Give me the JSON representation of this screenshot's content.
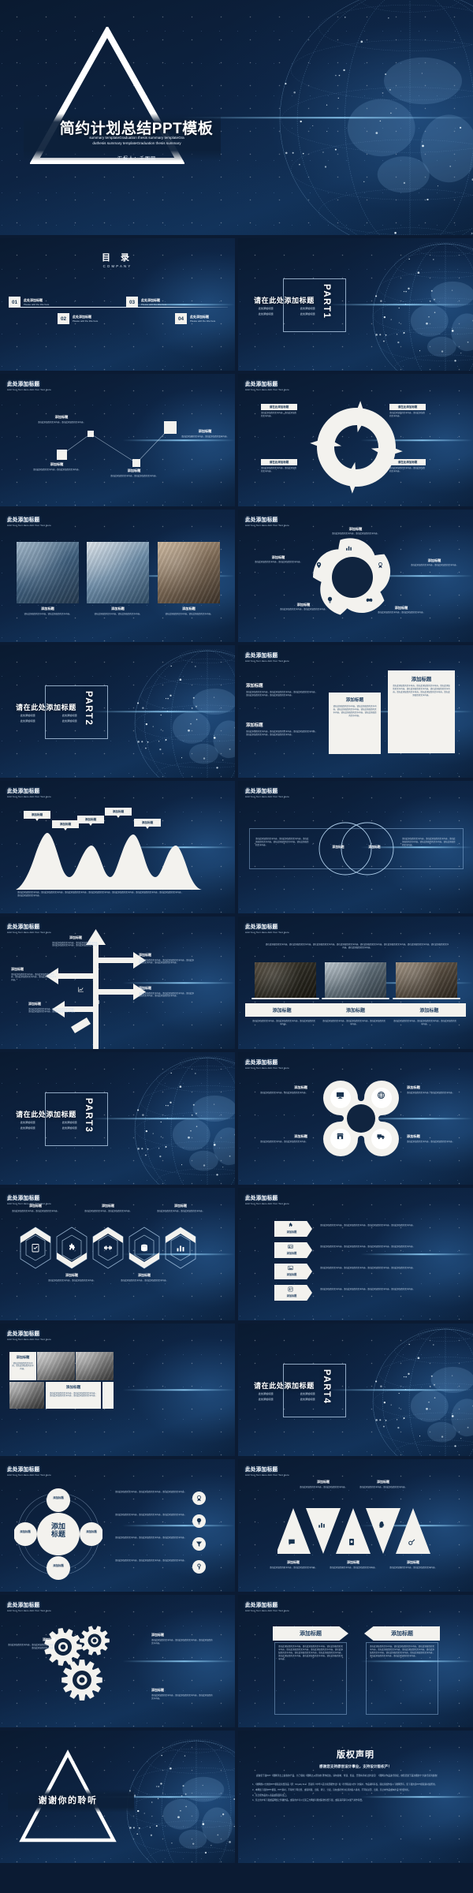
{
  "meta": {
    "accent": "#123055",
    "card": "#f3f2ee",
    "ink": "#17324f",
    "glow": "#8fc6ff"
  },
  "cover": {
    "title": "简约计划总结PPT模板",
    "subtitle_line1": "summary templateGraduation thesis summary templateGra",
    "subtitle_line2": "duthesis summary templateGraduation thesis summary",
    "presenter": "汇报人：千图网"
  },
  "toc": {
    "title": "目 录",
    "subtitle": "COMPANY",
    "items": [
      {
        "num": "01",
        "cn": "此处添加标题",
        "en": "Please add the title here"
      },
      {
        "num": "02",
        "cn": "此处添加标题",
        "en": "Please add the title here"
      },
      {
        "num": "03",
        "cn": "此处添加标题",
        "en": "Please add the title here"
      },
      {
        "num": "04",
        "cn": "此处添加标题",
        "en": "Please add the title here"
      }
    ]
  },
  "common": {
    "slide_title": "此处添加标题",
    "slide_subtitle": "Add Your Text Here Add Your Text Here",
    "add_title": "添加标题",
    "add_title_here": "请在此处添加标题",
    "body_short": "请在此添加您的文字内容，请在此添加您的文字内容。",
    "body_med": "请在此添加您的文字内容，请在此添加您的文字内容，请在此添加您的文字内容，请在此添加您的文字内容。",
    "body_long": "请在此添加您的文字内容，请在此添加您的文字内容，请在此添加您的文字内容，请在此添加您的文字内容，请在此添加您的文字内容，请在此添加您的文字内容，请在此添加您的文字内容。",
    "bullet": "此处添加标题"
  },
  "parts": [
    {
      "num": "PART1",
      "title": "请在此处添加标题",
      "bullets": [
        "此处添加标题",
        "此处添加标题",
        "此处添加标题",
        "此处添加标题"
      ]
    },
    {
      "num": "PART2",
      "title": "请在此处添加标题",
      "bullets": [
        "此处添加标题",
        "此处添加标题",
        "此处添加标题",
        "此处添加标题"
      ]
    },
    {
      "num": "PART3",
      "title": "请在此处添加标题",
      "bullets": [
        "此处添加标题",
        "此处添加标题",
        "此处添加标题",
        "此处添加标题"
      ]
    },
    {
      "num": "PART4",
      "title": "请在此处添加标题",
      "bullets": [
        "此处添加标题",
        "此处添加标题",
        "此处添加标题",
        "此处添加标题"
      ]
    }
  ],
  "zigzag": {
    "nodes": [
      {
        "label": "添加标题",
        "body": "请在此添加您的文字内容，请在此添加您的文字内容。"
      },
      {
        "label": "添加标题",
        "body": "请在此添加您的文字内容，请在此添加您的文字内容。"
      },
      {
        "label": "添加标题",
        "body": "请在此添加您的文字内容，请在此添加您的文字内容。"
      },
      {
        "label": "添加标题",
        "body": "请在此添加您的文字内容，请在此添加您的文字内容。"
      }
    ]
  },
  "cycle": {
    "items": [
      {
        "label": "请在此添加标题",
        "body": "请在此添加您的文字内容，请在此添加您的文字内容。"
      },
      {
        "label": "请在此添加标题",
        "body": "请在此添加您的文字内容，请在此添加您的文字内容。"
      },
      {
        "label": "请在此添加标题",
        "body": "请在此添加您的文字内容，请在此添加您的文字内容。"
      },
      {
        "label": "请在此添加标题",
        "body": "请在此添加您的文字内容，请在此添加您的文字内容。"
      }
    ]
  },
  "photos3": {
    "items": [
      {
        "label": "添加标题",
        "body": "请在此添加您的文字内容，请在此添加您的文字内容。"
      },
      {
        "label": "添加标题",
        "body": "请在此添加您的文字内容，请在此添加您的文字内容。"
      },
      {
        "label": "添加标题",
        "body": "请在此添加您的文字内容，请在此添加您的文字内容。"
      }
    ]
  },
  "pinwheel": {
    "items": [
      {
        "label": "添加标题",
        "body": "请在此添加您的文字内容，请在此添加您的文字内容。",
        "icon": "chart-bar-icon"
      },
      {
        "label": "添加标题",
        "body": "请在此添加您的文字内容，请在此添加您的文字内容。",
        "icon": "medal-icon"
      },
      {
        "label": "添加标题",
        "body": "请在此添加您的文字内容，请在此添加您的文字内容。",
        "icon": "handshake-icon"
      },
      {
        "label": "添加标题",
        "body": "请在此添加您的文字内容，请在此添加您的文字内容。",
        "icon": "lightbulb-icon"
      },
      {
        "label": "添加标题",
        "body": "请在此添加您的文字内容，请在此添加您的文字内容。",
        "icon": "location-pin-icon"
      }
    ]
  },
  "threecols": {
    "left": [
      {
        "label": "添加标题",
        "body": "请在此添加您的文字内容，请在此添加您的文字内容，请在此添加您的文字内容，请在此添加您的文字内容，请在此添加您的文字内容。"
      },
      {
        "label": "添加标题",
        "body": "请在此添加您的文字内容，请在此添加您的文字内容，请在此添加您的文字内容，请在此添加您的文字内容，请在此添加您的文字内容。"
      }
    ],
    "mid": {
      "label": "添加标题",
      "body": "请在此添加您的文字内容，请在此添加您的文字内容，请在此添加您的文字内容，请在此添加您的文字内容，请在此添加您的文字内容，请在此添加您的文字内容。"
    },
    "right": {
      "label": "添加标题",
      "body": "请在此添加您的文字内容，请在此添加您的文字内容，请在此添加您的文字内容，请在此添加您的文字内容，请在此添加您的文字内容，请在此添加您的文字内容，请在此添加您的文字内容，请在此添加您的文字内容。"
    }
  },
  "mountains": {
    "labels": [
      "添加标题",
      "添加标题",
      "添加标题",
      "添加标题",
      "添加标题"
    ],
    "caption": "请在此添加您的文字内容，请在此添加您的文字内容，请在此添加您的文字内容，请在此添加您的文字内容，请在此添加您的文字内容，请在此添加您的文字内容，请在此添加您的文字内容，请在此添加您的文字内容。"
  },
  "venn": {
    "left_body": "请在此添加您的文字内容，请在此添加您的文字内容，请在此添加您的文字内容，请在此添加您的文字内容，请在此添加您的文字内容。",
    "right_body": "请在此添加您的文字内容，请在此添加您的文字内容，请在此添加您的文字内容，请在此添加您的文字内容，请在此添加您的文字内容。",
    "circle_left": "添加标题",
    "circle_right": "添加标题"
  },
  "arrowtree": {
    "items": [
      {
        "label": "添加标题",
        "body": "请在此添加您的文字内容，请在此添加您的文字内容，请在此添加您的文字内容，请在此添加您的文字内容。",
        "icon": "globe-icon"
      },
      {
        "label": "添加标题",
        "body": "请在此添加您的文字内容，请在此添加您的文字内容，请在此添加您的文字内容，请在此添加您的文字内容。",
        "icon": "group-icon"
      },
      {
        "label": "添加标题",
        "body": "请在此添加您的文字内容，请在此添加您的文字内容，请在此添加您的文字内容，请在此添加您的文字内容。",
        "icon": "chart-line-icon"
      },
      {
        "label": "添加标题",
        "body": "请在此添加您的文字内容，请在此添加您的文字内容，请在此添加您的文字内容，请在此添加您的文字内容。",
        "icon": "football-icon"
      },
      {
        "label": "添加标题",
        "body": "请在此添加您的文字内容，请在此添加您的文字内容，请在此添加您的文字内容，请在此添加您的文字内容。",
        "icon": "paper-plane-icon"
      }
    ]
  },
  "laptops": {
    "intro": "请在此添加您的文字内容，请在此添加您的文字内容，请在此添加您的文字内容，请在此添加您的文字内容，请在此添加您的文字内容，请在此添加您的文字内容，请在此添加您的文字内容，请在此添加您的文字内容，请在此添加您的文字内容。",
    "items": [
      {
        "label": "添加标题",
        "body": "请在此添加您的文字内容，请在此添加您的文字内容，请在此添加您的文字内容。"
      },
      {
        "label": "添加标题",
        "body": "请在此添加您的文字内容，请在此添加您的文字内容，请在此添加您的文字内容。"
      },
      {
        "label": "添加标题",
        "body": "请在此添加您的文字内容，请在此添加您的文字内容，请在此添加您的文字内容。"
      }
    ]
  },
  "quadhub": {
    "items": [
      {
        "label": "添加标题",
        "body": "请在此添加您的文字内容，请在此添加您的文字内容。",
        "icon": "monitor-icon"
      },
      {
        "label": "添加标题",
        "body": "请在此添加您的文字内容，请在此添加您的文字内容。",
        "icon": "globe-grid-icon"
      },
      {
        "label": "添加标题",
        "body": "请在此添加您的文字内容，请在此添加您的文字内容。",
        "icon": "store-icon"
      },
      {
        "label": "添加标题",
        "body": "请在此添加您的文字内容，请在此添加您的文字内容。",
        "icon": "truck-icon"
      }
    ]
  },
  "hexicons": {
    "items": [
      {
        "label": "添加标题",
        "body": "请在此添加您的文字内容，请在此添加您的文字内容。",
        "icon": "checklist-icon"
      },
      {
        "label": "添加标题",
        "body": "请在此添加您的文字内容，请在此添加您的文字内容。",
        "icon": "puzzle-icon"
      },
      {
        "label": "添加标题",
        "body": "请在此添加您的文字内容，请在此添加您的文字内容。",
        "icon": "dumbbell-icon"
      },
      {
        "label": "添加标题",
        "body": "请在此添加您的文字内容，请在此添加您的文字内容。",
        "icon": "database-icon"
      },
      {
        "label": "添加标题",
        "body": "请在此添加您的文字内容，请在此添加您的文字内容。",
        "icon": "bar-chart-icon"
      }
    ]
  },
  "chevrons": {
    "items": [
      {
        "label": "添加标题",
        "body": "请在此添加您的文字内容。请在此添加您的文字内容。请在此添加您的文字内容。请在此添加您的文字内容。",
        "icon": "puzzle-piece-icon"
      },
      {
        "label": "添加标题",
        "body": "请在此添加您的文字内容。请在此添加您的文字内容。请在此添加您的文字内容。请在此添加您的文字内容。",
        "icon": "id-card-icon"
      },
      {
        "label": "添加标题",
        "body": "请在此添加您的文字内容。请在此添加您的文字内容。请在此添加您的文字内容。请在此添加您的文字内容。",
        "icon": "picture-icon"
      },
      {
        "label": "添加标题",
        "body": "请在此添加您的文字内容。请在此添加您的文字内容。请在此添加您的文字内容。请在此添加您的文字内容。",
        "icon": "contacts-icon"
      }
    ]
  },
  "mosaic": {
    "cell1": {
      "label": "添加标题",
      "body": "请在此添加您的文字内容，请在此添加您的文字内容。"
    },
    "cell2": {
      "label": "添加标题",
      "body": "请在此添加您的文字内容，请在此添加您的文字内容，请在此添加您的文字内容，请在此添加您的文字内容。"
    }
  },
  "centerhub": {
    "center_line1": "添加",
    "center_line2": "标题",
    "satellites": [
      "添加标题",
      "添加标题",
      "添加标题",
      "添加标题"
    ],
    "rows": [
      {
        "body": "请在此添加您的文字内容，请在此添加您的文字内容，请在此添加您的文字内容。",
        "icon": "award-icon"
      },
      {
        "body": "请在此添加您的文字内容，请在此添加您的文字内容，请在此添加您的文字内容。",
        "icon": "lightbulb-icon"
      },
      {
        "body": "请在此添加您的文字内容，请在此添加您的文字内容，请在此添加您的文字内容。",
        "icon": "funnel-icon"
      },
      {
        "body": "请在此添加您的文字内容，请在此添加您的文字内容，请在此添加您的文字内容。",
        "icon": "key-icon"
      }
    ]
  },
  "triangles": {
    "top": [
      {
        "label": "添加标题",
        "body": "请在此添加您的文字内容，请在此添加您的文字内容。"
      },
      {
        "label": "添加标题",
        "body": "请在此添加您的文字内容，请在此添加您的文字内容。"
      }
    ],
    "bottom": [
      {
        "label": "添加标题",
        "body": "请在此添加您的文字内容，请在此添加您的文字内容。"
      },
      {
        "label": "添加标题",
        "body": "请在此添加您的文字内容，请在此添加您的文字内容。"
      },
      {
        "label": "添加标题",
        "body": "请在此添加您的文字内容，请在此添加您的文字内容。"
      }
    ],
    "icons": [
      "chat-icon",
      "bar-chart-icon",
      "mobile-icon",
      "head-idea-icon",
      "wrench-gear-icon"
    ]
  },
  "gears": {
    "left": {
      "label": "添加标题",
      "body": "请在此添加您的文字内容，请在此添加您的文字内容，请在此添加您的文字内容。"
    },
    "right_top": {
      "label": "添加标题",
      "body": "请在此添加您的文字内容，请在此添加您的文字内容，请在此添加您的文字内容。"
    },
    "right_bottom": {
      "label": "添加标题",
      "body": "请在此添加您的文字内容，请在此添加您的文字内容，请在此添加您的文字内容。"
    }
  },
  "banners": {
    "left": {
      "label": "添加标题",
      "body": "请在此添加您的文字内容，请在此添加您的文字内容，请在此添加您的文字内容，请在此添加您的文字内容，请在此添加您的文字内容，请在此添加您的文字内容，请在此添加您的文字内容，请在此添加您的文字内容，请在此添加您的文字内容，请在此添加您的文字内容，请在此添加您的文字内容。"
    },
    "right": {
      "label": "添加标题",
      "body": "请在此添加您的文字内容，请在此添加您的文字内容，请在此添加您的文字内容，请在此添加您的文字内容，请在此添加您的文字内容，请在此添加您的文字内容，请在此添加您的文字内容，请在此添加您的文字内容，请在此添加您的文字内容，请在此添加您的文字内容。"
    }
  },
  "thanks": {
    "text": "谢谢你的聆听"
  },
  "copyright": {
    "title": "版权声明",
    "subtitle": "感谢您支持原创设计事业，支持设计版权产！",
    "intro": "感谢您下载PPT《图网平台上提供的产品，为了保和《图网之从原创的 著作权益，请勿复制、传递、售卖，否则将承担法律责任！《图网对作品进行授权，依照范围下届次图的十分进行系列加收！",
    "items": [
      "1、《图网阁以全类的PPT模版是免费商品（即：Royalty free）且取得《中华人民共和国著作法》和《世界版权公约》的保护，作品资料有权，版权永属作权以下图网所有，您下载的该PPT模版素材如所用。",
      "2、本网络下载的PPT模版、PPT素材，不得用于再出售、或者转载、出版、转让、分发，旨在或者作为礼养的私人素材，不同标识形、出版，禁止本作品或本补设计的套制礼。",
      "3、禁止把作品的入商品或画面等出口。",
      "4、禁止用户将下载或设网络上传播作品，或者用户可以让第三方网络可能成其他免费下载，或者其间请可以属气书作有偿。"
    ]
  }
}
